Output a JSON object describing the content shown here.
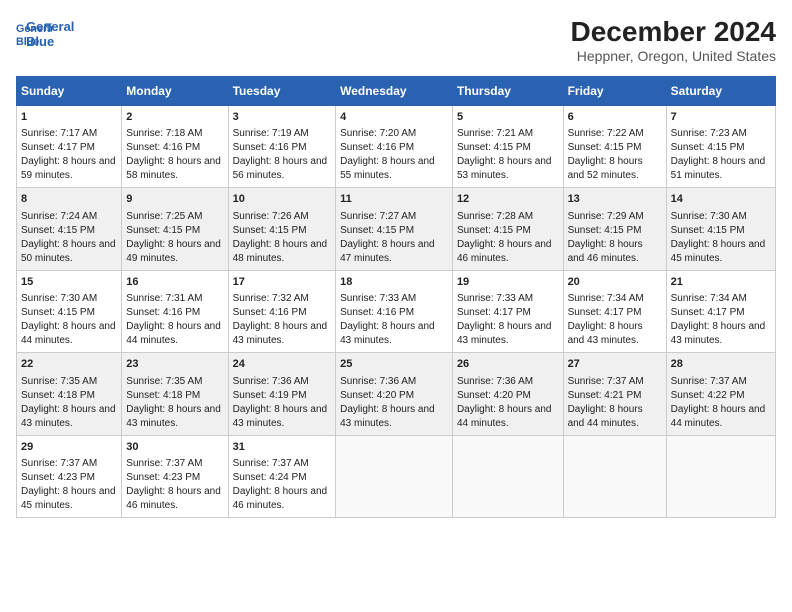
{
  "logo": {
    "line1": "General",
    "line2": "Blue"
  },
  "title": "December 2024",
  "subtitle": "Heppner, Oregon, United States",
  "header": {
    "days": [
      "Sunday",
      "Monday",
      "Tuesday",
      "Wednesday",
      "Thursday",
      "Friday",
      "Saturday"
    ]
  },
  "weeks": [
    [
      {
        "day": "1",
        "sunrise": "Sunrise: 7:17 AM",
        "sunset": "Sunset: 4:17 PM",
        "daylight": "Daylight: 8 hours and 59 minutes."
      },
      {
        "day": "2",
        "sunrise": "Sunrise: 7:18 AM",
        "sunset": "Sunset: 4:16 PM",
        "daylight": "Daylight: 8 hours and 58 minutes."
      },
      {
        "day": "3",
        "sunrise": "Sunrise: 7:19 AM",
        "sunset": "Sunset: 4:16 PM",
        "daylight": "Daylight: 8 hours and 56 minutes."
      },
      {
        "day": "4",
        "sunrise": "Sunrise: 7:20 AM",
        "sunset": "Sunset: 4:16 PM",
        "daylight": "Daylight: 8 hours and 55 minutes."
      },
      {
        "day": "5",
        "sunrise": "Sunrise: 7:21 AM",
        "sunset": "Sunset: 4:15 PM",
        "daylight": "Daylight: 8 hours and 53 minutes."
      },
      {
        "day": "6",
        "sunrise": "Sunrise: 7:22 AM",
        "sunset": "Sunset: 4:15 PM",
        "daylight": "Daylight: 8 hours and 52 minutes."
      },
      {
        "day": "7",
        "sunrise": "Sunrise: 7:23 AM",
        "sunset": "Sunset: 4:15 PM",
        "daylight": "Daylight: 8 hours and 51 minutes."
      }
    ],
    [
      {
        "day": "8",
        "sunrise": "Sunrise: 7:24 AM",
        "sunset": "Sunset: 4:15 PM",
        "daylight": "Daylight: 8 hours and 50 minutes."
      },
      {
        "day": "9",
        "sunrise": "Sunrise: 7:25 AM",
        "sunset": "Sunset: 4:15 PM",
        "daylight": "Daylight: 8 hours and 49 minutes."
      },
      {
        "day": "10",
        "sunrise": "Sunrise: 7:26 AM",
        "sunset": "Sunset: 4:15 PM",
        "daylight": "Daylight: 8 hours and 48 minutes."
      },
      {
        "day": "11",
        "sunrise": "Sunrise: 7:27 AM",
        "sunset": "Sunset: 4:15 PM",
        "daylight": "Daylight: 8 hours and 47 minutes."
      },
      {
        "day": "12",
        "sunrise": "Sunrise: 7:28 AM",
        "sunset": "Sunset: 4:15 PM",
        "daylight": "Daylight: 8 hours and 46 minutes."
      },
      {
        "day": "13",
        "sunrise": "Sunrise: 7:29 AM",
        "sunset": "Sunset: 4:15 PM",
        "daylight": "Daylight: 8 hours and 46 minutes."
      },
      {
        "day": "14",
        "sunrise": "Sunrise: 7:30 AM",
        "sunset": "Sunset: 4:15 PM",
        "daylight": "Daylight: 8 hours and 45 minutes."
      }
    ],
    [
      {
        "day": "15",
        "sunrise": "Sunrise: 7:30 AM",
        "sunset": "Sunset: 4:15 PM",
        "daylight": "Daylight: 8 hours and 44 minutes."
      },
      {
        "day": "16",
        "sunrise": "Sunrise: 7:31 AM",
        "sunset": "Sunset: 4:16 PM",
        "daylight": "Daylight: 8 hours and 44 minutes."
      },
      {
        "day": "17",
        "sunrise": "Sunrise: 7:32 AM",
        "sunset": "Sunset: 4:16 PM",
        "daylight": "Daylight: 8 hours and 43 minutes."
      },
      {
        "day": "18",
        "sunrise": "Sunrise: 7:33 AM",
        "sunset": "Sunset: 4:16 PM",
        "daylight": "Daylight: 8 hours and 43 minutes."
      },
      {
        "day": "19",
        "sunrise": "Sunrise: 7:33 AM",
        "sunset": "Sunset: 4:17 PM",
        "daylight": "Daylight: 8 hours and 43 minutes."
      },
      {
        "day": "20",
        "sunrise": "Sunrise: 7:34 AM",
        "sunset": "Sunset: 4:17 PM",
        "daylight": "Daylight: 8 hours and 43 minutes."
      },
      {
        "day": "21",
        "sunrise": "Sunrise: 7:34 AM",
        "sunset": "Sunset: 4:17 PM",
        "daylight": "Daylight: 8 hours and 43 minutes."
      }
    ],
    [
      {
        "day": "22",
        "sunrise": "Sunrise: 7:35 AM",
        "sunset": "Sunset: 4:18 PM",
        "daylight": "Daylight: 8 hours and 43 minutes."
      },
      {
        "day": "23",
        "sunrise": "Sunrise: 7:35 AM",
        "sunset": "Sunset: 4:18 PM",
        "daylight": "Daylight: 8 hours and 43 minutes."
      },
      {
        "day": "24",
        "sunrise": "Sunrise: 7:36 AM",
        "sunset": "Sunset: 4:19 PM",
        "daylight": "Daylight: 8 hours and 43 minutes."
      },
      {
        "day": "25",
        "sunrise": "Sunrise: 7:36 AM",
        "sunset": "Sunset: 4:20 PM",
        "daylight": "Daylight: 8 hours and 43 minutes."
      },
      {
        "day": "26",
        "sunrise": "Sunrise: 7:36 AM",
        "sunset": "Sunset: 4:20 PM",
        "daylight": "Daylight: 8 hours and 44 minutes."
      },
      {
        "day": "27",
        "sunrise": "Sunrise: 7:37 AM",
        "sunset": "Sunset: 4:21 PM",
        "daylight": "Daylight: 8 hours and 44 minutes."
      },
      {
        "day": "28",
        "sunrise": "Sunrise: 7:37 AM",
        "sunset": "Sunset: 4:22 PM",
        "daylight": "Daylight: 8 hours and 44 minutes."
      }
    ],
    [
      {
        "day": "29",
        "sunrise": "Sunrise: 7:37 AM",
        "sunset": "Sunset: 4:23 PM",
        "daylight": "Daylight: 8 hours and 45 minutes."
      },
      {
        "day": "30",
        "sunrise": "Sunrise: 7:37 AM",
        "sunset": "Sunset: 4:23 PM",
        "daylight": "Daylight: 8 hours and 46 minutes."
      },
      {
        "day": "31",
        "sunrise": "Sunrise: 7:37 AM",
        "sunset": "Sunset: 4:24 PM",
        "daylight": "Daylight: 8 hours and 46 minutes."
      },
      null,
      null,
      null,
      null
    ]
  ]
}
